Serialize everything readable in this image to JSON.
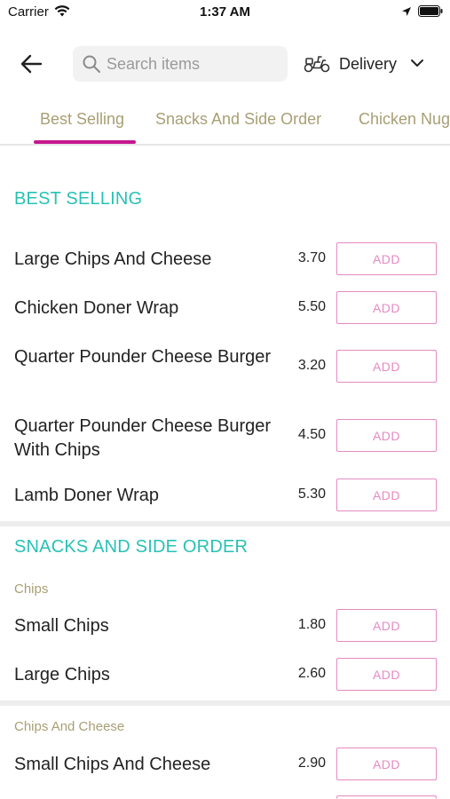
{
  "status_bar": {
    "carrier": "Carrier",
    "time": "1:37 AM"
  },
  "header": {
    "search_placeholder": "Search items",
    "delivery_label": "Delivery"
  },
  "tabs": [
    "Best Selling",
    "Snacks And Side Order",
    "Chicken Nuggets"
  ],
  "active_tab": "Best Selling",
  "colors": {
    "accent_pink": "#c5178f",
    "section_teal": "#29c1b5",
    "subcategory_tan": "#a89f74",
    "add_border": "#e58ac3"
  },
  "sections": [
    {
      "title": "BEST SELLING",
      "items": [
        {
          "name": "Large Chips And Cheese",
          "price": "3.70",
          "action": "ADD"
        },
        {
          "name": "Chicken Doner Wrap",
          "price": "5.50",
          "action": "ADD"
        },
        {
          "name": "Quarter Pounder Cheese Burger",
          "price": "3.20",
          "action": "ADD"
        },
        {
          "name": "Quarter Pounder Cheese Burger With Chips",
          "price": "4.50",
          "action": "ADD"
        },
        {
          "name": "Lamb Doner Wrap",
          "price": "5.30",
          "action": "ADD"
        }
      ]
    },
    {
      "title": "SNACKS AND SIDE ORDER",
      "subcategories": [
        {
          "name": "Chips",
          "items": [
            {
              "name": "Small Chips",
              "price": "1.80",
              "action": "ADD"
            },
            {
              "name": "Large Chips",
              "price": "2.60",
              "action": "ADD"
            }
          ]
        },
        {
          "name": "Chips And Cheese",
          "items": [
            {
              "name": "Small Chips And Cheese",
              "price": "2.90",
              "action": "ADD"
            }
          ]
        }
      ]
    }
  ]
}
